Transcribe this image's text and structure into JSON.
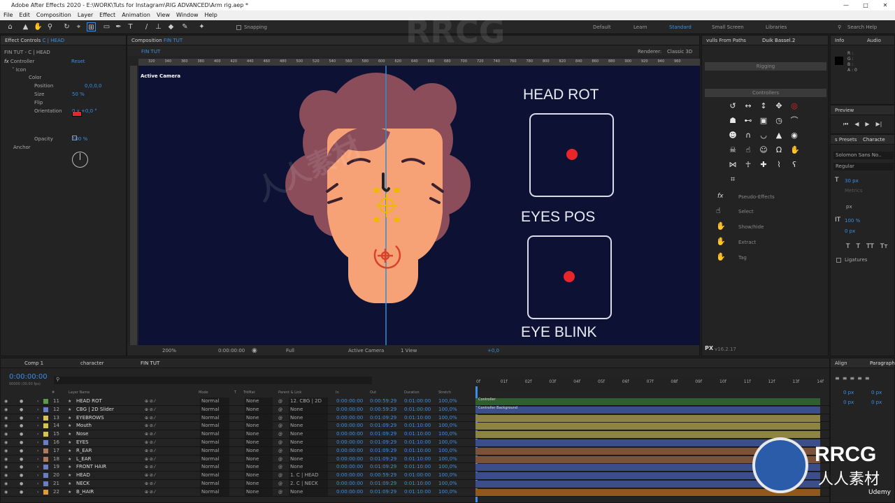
{
  "window": {
    "title": "Adobe After Effects 2020 - E:\\WORK\\Tuts for Instagram\\RIG ADVANCED\\Arm rig.aep *"
  },
  "menu": [
    "File",
    "Edit",
    "Composition",
    "Layer",
    "Effect",
    "Animation",
    "View",
    "Window",
    "Help"
  ],
  "toolbar": {
    "snapping": "Snapping",
    "workspaces": [
      "Default",
      "Learn",
      "Standard",
      "Small Screen",
      "Libraries"
    ],
    "search": "Search Help"
  },
  "effect_controls": {
    "tab": "Effect Controls",
    "tab_target": "C | HEAD",
    "path": "FIN TUT - C | HEAD",
    "effect_name": "Controller",
    "reset": "Reset",
    "group": "Icon",
    "props": [
      {
        "name": "Color",
        "value": ""
      },
      {
        "name": "Position",
        "value": "0,0,0,0"
      },
      {
        "name": "Size",
        "value": "50 %"
      },
      {
        "name": "Flip",
        "value": ""
      },
      {
        "name": "Orientation",
        "value": "0 x +0,0 °"
      },
      {
        "name": "Opacity",
        "value": "100 %"
      }
    ],
    "anchor": "Anchor"
  },
  "composition": {
    "tab": "Composition",
    "tab_name": "FIN TUT",
    "sub_tab": "FIN TUT",
    "renderer_label": "Renderer:",
    "renderer": "Classic 3D",
    "camera_label": "Active Camera",
    "ruler_ticks": [
      "320",
      "340",
      "360",
      "380",
      "400",
      "420",
      "440",
      "460",
      "480",
      "500",
      "520",
      "540",
      "560",
      "580",
      "600",
      "620",
      "640",
      "660",
      "680",
      "700",
      "720",
      "740",
      "760",
      "780",
      "800",
      "820",
      "840",
      "860",
      "880",
      "900",
      "920",
      "940",
      "960"
    ],
    "controls": [
      "HEAD ROT",
      "EYES POS",
      "EYE BLINK"
    ],
    "footer": {
      "zoom": "200%",
      "time": "0:00:00:00",
      "quality": "Full",
      "camera": "Active Camera",
      "views": "1 View",
      "offset": "+0,0"
    }
  },
  "duik": {
    "tab_left": "vulls From Paths",
    "tab": "Duik Bassel.2",
    "rigging": "Rigging",
    "controllers": "Controllers",
    "icons": [
      "rotate",
      "horizontal",
      "vertical",
      "move",
      "target",
      "body",
      "slider",
      "square",
      "clock",
      "line",
      "head",
      "arch",
      "lips",
      "drop",
      "eye",
      "skull",
      "finger",
      "face",
      "ear",
      "hand",
      "butterfly",
      "figure",
      "cross",
      "feather",
      "hook",
      "frame"
    ],
    "pseudo": "Pseudo-Effects",
    "menu": [
      "Select",
      "Show/hide",
      "Extract",
      "Tag"
    ],
    "version": "v16.2.17"
  },
  "info": {
    "tabs": [
      "Info",
      "Audio"
    ],
    "r": "R :",
    "g": "G :",
    "b": "B :",
    "a": "A : 0"
  },
  "preview": {
    "label": "Preview"
  },
  "character": {
    "tabs": [
      "s Presets",
      "Characte"
    ],
    "font": "Solomon Sans No..",
    "style": "Regular",
    "size": "30 px",
    "leading": "Metrics",
    "tracking": "100 %",
    "baseline": "0 px",
    "scale": "0 %",
    "ligatures": "Ligatures",
    "unit": "px"
  },
  "align": {
    "tabs": [
      "Align",
      "Paragraph"
    ],
    "indents": [
      "0 px",
      "0 px",
      "0 px",
      "0 px"
    ]
  },
  "timeline": {
    "tabs": [
      "Comp 1",
      "character",
      "FIN TUT"
    ],
    "timecode": "0:00:00:00",
    "fps": "00000 (30.00 fps)",
    "columns": [
      "#",
      "Layer Name",
      "Mode",
      "T",
      "TrkMat",
      "Parent & Link",
      "In",
      "Out",
      "Duration",
      "Stretch"
    ],
    "ticks": [
      "0f",
      "01f",
      "02f",
      "03f",
      "04f",
      "05f",
      "06f",
      "07f",
      "08f",
      "09f",
      "10f",
      "11f",
      "12f",
      "13f",
      "14f"
    ],
    "layers": [
      {
        "num": "11",
        "name": "HEAD ROT",
        "mode": "Normal",
        "trk": "None",
        "parent": "12. CBG | 2D",
        "in": "0:00:00:00",
        "out": "0:00:59:29",
        "dur": "0:01:00:00",
        "stretch": "100,0%",
        "color": "#5a9a4a",
        "bar": "#2f5f2f"
      },
      {
        "num": "12",
        "name": "CBG | 2D Slider",
        "mode": "Normal",
        "trk": "None",
        "parent": "None",
        "in": "0:00:00:00",
        "out": "0:00:59:29",
        "dur": "0:01:00:00",
        "stretch": "100,0%",
        "color": "#6a7ec8",
        "bar": "#3b4e8a"
      },
      {
        "num": "13",
        "name": "EYEBROWS",
        "mode": "Normal",
        "trk": "None",
        "parent": "None",
        "in": "0:00:00:00",
        "out": "0:01:09:29",
        "dur": "0:01:10:00",
        "stretch": "100,0%",
        "color": "#d6c452",
        "bar": "#8c8440"
      },
      {
        "num": "14",
        "name": "Mouth",
        "mode": "Normal",
        "trk": "None",
        "parent": "None",
        "in": "0:00:00:00",
        "out": "0:01:09:29",
        "dur": "0:01:10:00",
        "stretch": "100,0%",
        "color": "#d6c452",
        "bar": "#8c8440"
      },
      {
        "num": "15",
        "name": "Nose",
        "mode": "Normal",
        "trk": "None",
        "parent": "None",
        "in": "0:00:00:00",
        "out": "0:01:09:29",
        "dur": "0:01:10:00",
        "stretch": "100,0%",
        "color": "#d6c452",
        "bar": "#8c8440"
      },
      {
        "num": "16",
        "name": "EYES",
        "mode": "Normal",
        "trk": "None",
        "parent": "None",
        "in": "0:00:00:00",
        "out": "0:01:09:29",
        "dur": "0:01:10:00",
        "stretch": "100,0%",
        "color": "#6a7ec8",
        "bar": "#3b4e8a"
      },
      {
        "num": "17",
        "name": "R_EAR",
        "mode": "Normal",
        "trk": "None",
        "parent": "None",
        "in": "0:00:00:00",
        "out": "0:01:09:29",
        "dur": "0:01:10:00",
        "stretch": "100,0%",
        "color": "#b07a5a",
        "bar": "#7a5238"
      },
      {
        "num": "18",
        "name": "L_EAR",
        "mode": "Normal",
        "trk": "None",
        "parent": "None",
        "in": "0:00:00:00",
        "out": "0:01:09:29",
        "dur": "0:01:10:00",
        "stretch": "100,0%",
        "color": "#b07a5a",
        "bar": "#7a5238"
      },
      {
        "num": "19",
        "name": "FRONT HAIR",
        "mode": "Normal",
        "trk": "None",
        "parent": "None",
        "in": "0:00:00:00",
        "out": "0:01:09:29",
        "dur": "0:01:10:00",
        "stretch": "100,0%",
        "color": "#6a7ec8",
        "bar": "#3b4e8a"
      },
      {
        "num": "20",
        "name": "HEAD",
        "mode": "Normal",
        "trk": "None",
        "parent": "1. C | HEAD",
        "in": "0:00:00:00",
        "out": "0:00:59:29",
        "dur": "0:01:00:00",
        "stretch": "100,0%",
        "color": "#6a7ec8",
        "bar": "#3b4e8a"
      },
      {
        "num": "21",
        "name": "NECK",
        "mode": "Normal",
        "trk": "None",
        "parent": "2. C | NECK",
        "in": "0:00:00:00",
        "out": "0:01:09:29",
        "dur": "0:01:10:00",
        "stretch": "100,0%",
        "color": "#6a7ec8",
        "bar": "#3b4e8a"
      },
      {
        "num": "22",
        "name": "B_HAIR",
        "mode": "Normal",
        "trk": "None",
        "parent": "None",
        "in": "0:00:00:00",
        "out": "0:01:09:29",
        "dur": "0:01:10:00",
        "stretch": "100,0%",
        "color": "#e09a3a",
        "bar": "#8c5a20"
      }
    ],
    "bar_labels": [
      "Controller",
      "Controller Background"
    ]
  },
  "watermark": {
    "big": "RRCG",
    "cn": "人人素材",
    "udemy": "Udemy"
  },
  "colors": {
    "accent": "#3b8fe6",
    "canvas": "#0d1235",
    "skin": "#f7a276",
    "hair": "#8b4d5a",
    "dot": "#e8262a"
  }
}
